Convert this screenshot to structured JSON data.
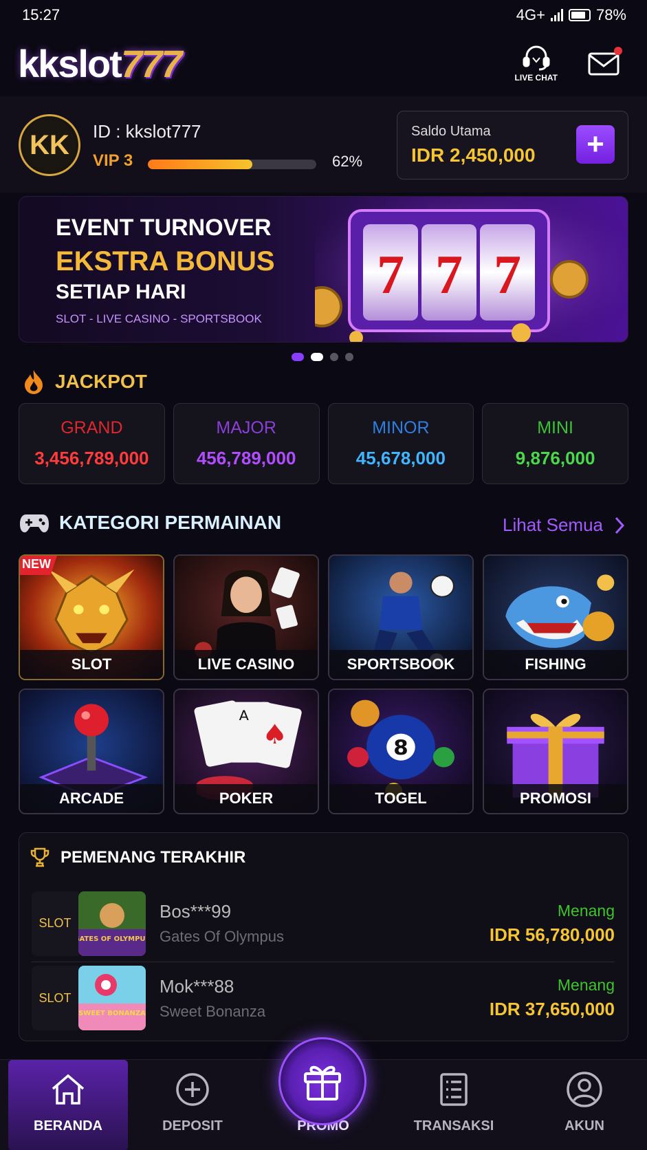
{
  "status_bar": {
    "time": "15:27",
    "network": "4G+",
    "battery": "78%"
  },
  "header": {
    "logo_white": "kkslot",
    "logo_gold": "777",
    "live_chat_label": "LIVE CHAT"
  },
  "profile": {
    "avatar_initials": "KK",
    "user_id": "ID : kkslot777",
    "vip_level": "VIP 3",
    "vip_progress_pct": 62,
    "vip_progress_label": "62%",
    "balance_label": "Saldo Utama",
    "balance_value": "IDR 2,450,000"
  },
  "banner": {
    "line1": "EVENT TURNOVER",
    "line2": "EKSTRA BONUS",
    "line3": "SETIAP HARI",
    "line4": "SLOT - LIVE CASINO - SPORTSBOOK",
    "active_slide": 1,
    "slide_count": 4
  },
  "jackpot": {
    "title": "JACKPOT",
    "items": [
      {
        "name": "GRAND",
        "value": "3,456,789,000",
        "name_color": "#e0262f",
        "value_color": "#ff3b3b"
      },
      {
        "name": "MAJOR",
        "value": "456,789,000",
        "name_color": "#8b3fd8",
        "value_color": "#b14dff"
      },
      {
        "name": "MINOR",
        "value": "45,678,000",
        "name_color": "#2f7fe0",
        "value_color": "#3fb6ff"
      },
      {
        "name": "MINI",
        "value": "9,876,000",
        "name_color": "#3cc235",
        "value_color": "#4ad94a"
      }
    ]
  },
  "categories": {
    "title": "KATEGORI PERMAINAN",
    "see_all": "Lihat Semua",
    "new_badge": "NEW",
    "items": [
      {
        "label": "SLOT",
        "icon": "dragon"
      },
      {
        "label": "LIVE CASINO",
        "icon": "dealer"
      },
      {
        "label": "SPORTSBOOK",
        "icon": "football-player"
      },
      {
        "label": "FISHING",
        "icon": "shark"
      },
      {
        "label": "ARCADE",
        "icon": "joystick"
      },
      {
        "label": "POKER",
        "icon": "playing-cards"
      },
      {
        "label": "TOGEL",
        "icon": "eight-ball"
      },
      {
        "label": "PROMOSI",
        "icon": "gift-box"
      }
    ]
  },
  "winners": {
    "title": "PEMENANG TERAKHIR",
    "items": [
      {
        "category": "SLOT",
        "user": "Bos***99",
        "game": "Gates Of Olympus",
        "status": "Menang",
        "amount": "IDR 56,780,000",
        "thumb_text": "GATES OF OLYMPUS"
      },
      {
        "category": "SLOT",
        "user": "Mok***88",
        "game": "Sweet Bonanza",
        "status": "Menang",
        "amount": "IDR 37,650,000",
        "thumb_text": "SWEET BONANZA"
      }
    ]
  },
  "bottom_nav": {
    "items": [
      {
        "label": "BERANDA",
        "icon": "home-icon"
      },
      {
        "label": "DEPOSIT",
        "icon": "plus-circle-icon"
      },
      {
        "label": "PROMO",
        "icon": "gift-icon"
      },
      {
        "label": "TRANSAKSI",
        "icon": "receipt-icon"
      },
      {
        "label": "AKUN",
        "icon": "user-icon"
      }
    ],
    "active": "BERANDA"
  }
}
